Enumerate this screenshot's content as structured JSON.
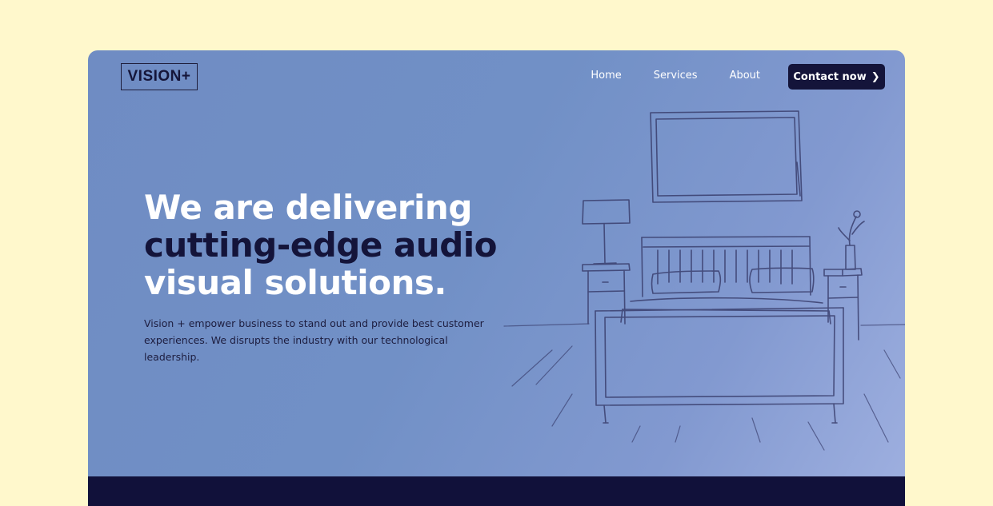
{
  "brand": {
    "logo_text": "VISION+"
  },
  "nav": {
    "items": [
      {
        "label": "Home"
      },
      {
        "label": "Services"
      },
      {
        "label": "About"
      }
    ],
    "cta_label": "Contact now"
  },
  "hero": {
    "headline_line1": "We are delivering",
    "headline_line2": "cutting-edge audio",
    "headline_line3": "visual solutions.",
    "description": "Vision + empower business to stand out and provide best customer experiences. We disrupts the industry with our technological leadership."
  },
  "colors": {
    "page_background": "#fff8cc",
    "hero_background": "#7190c6",
    "accent_dark": "#14143a",
    "text_light": "#ffffff"
  },
  "icons": {
    "cta_icon": "chevron-right-icon",
    "illustration": "bedroom-sketch"
  }
}
